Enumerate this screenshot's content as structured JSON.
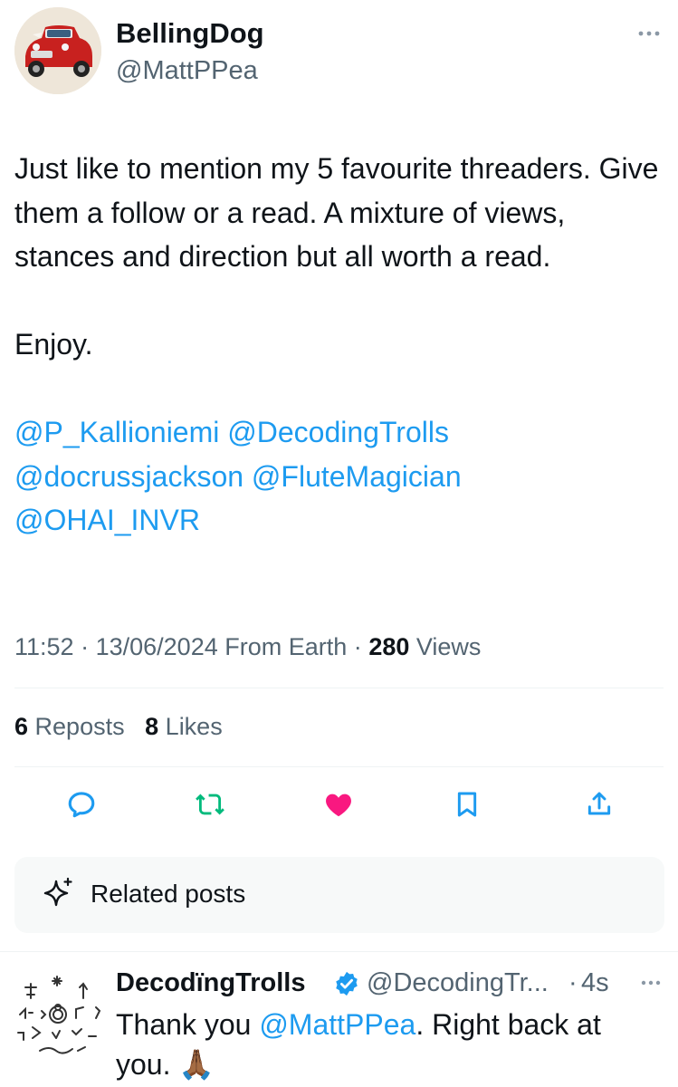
{
  "author": {
    "display_name": "BellingDog",
    "handle": "@MattPPea",
    "avatar_icon": "red-mini-car-avatar"
  },
  "tweet": {
    "line1": "Just like to mention my 5 favourite threaders. Give them a follow or a read. A mixture of views, stances and direction but all worth a read.",
    "line2": "Enjoy.",
    "mentions": [
      "@P_Kallioniemi",
      "@DecodingTrolls",
      "@docrussjackson",
      "@FluteMagician",
      "@OHAI_INVR"
    ]
  },
  "meta": {
    "time": "11:52",
    "sep1": "·",
    "date": "13/06/2024",
    "source": "From Earth",
    "sep2": "·",
    "views_count": "280",
    "views_label": "Views"
  },
  "stats": {
    "reposts_count": "6",
    "reposts_label": "Reposts",
    "likes_count": "8",
    "likes_label": "Likes"
  },
  "actions": [
    {
      "name": "reply-icon",
      "color": "#1d9bf0"
    },
    {
      "name": "repost-icon",
      "color": "#00ba7c"
    },
    {
      "name": "like-icon",
      "color": "#f91880"
    },
    {
      "name": "bookmark-icon",
      "color": "#1d9bf0"
    },
    {
      "name": "share-icon",
      "color": "#1d9bf0"
    }
  ],
  "related": {
    "label": "Related posts",
    "icon": "sparkle-icon"
  },
  "reply": {
    "display_name": "DecodïngTrolls",
    "verified_icon": "verified-badge-icon",
    "handle": "@DecodingTr...",
    "dot": "·",
    "time": "4s",
    "text_before": "Thank you ",
    "mention": "@MattPPea",
    "text_after": ". Right back at you. 🙏🏾"
  }
}
